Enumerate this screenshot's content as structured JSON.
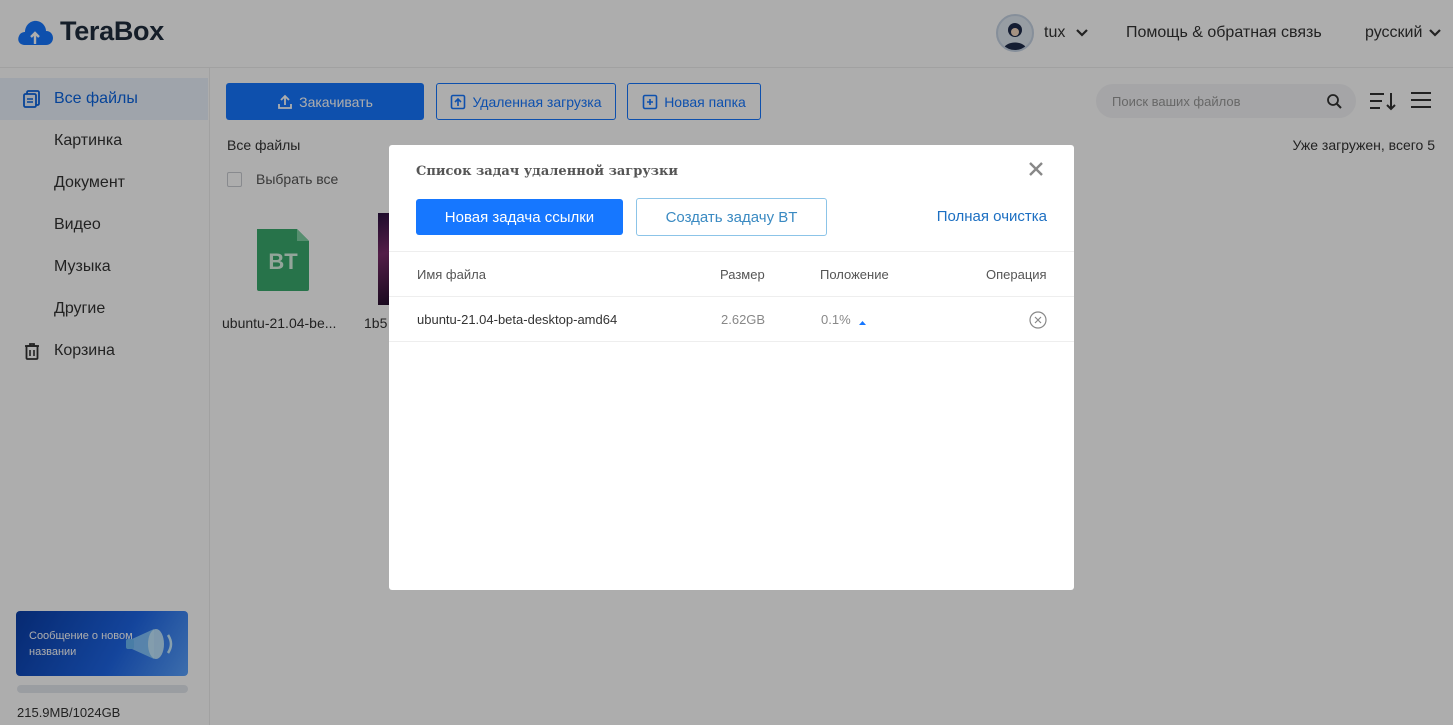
{
  "header": {
    "brand": "TeraBox",
    "username": "tux",
    "help_link": "Помощь & обратная связь",
    "language": "русский"
  },
  "sidebar": {
    "items": [
      {
        "label": "Все файлы",
        "icon": "files-icon",
        "active": true
      },
      {
        "label": "Картинка"
      },
      {
        "label": "Документ"
      },
      {
        "label": "Видео"
      },
      {
        "label": "Музыка"
      },
      {
        "label": "Другие"
      },
      {
        "label": "Корзина",
        "icon": "trash-icon"
      }
    ],
    "promo_text": "Сообщение о новом названии",
    "quota_text": "215.9MB/1024GB",
    "quota_used_fraction": 0.0002
  },
  "toolbar": {
    "upload_label": "Закачивать",
    "remote_label": "Удаленная загрузка",
    "new_folder_label": "Новая папка",
    "search_placeholder": "Поиск ваших файлов"
  },
  "content": {
    "breadcrumb": "Все файлы",
    "loaded_status": "Уже загружен, всего 5",
    "select_all": "Выбрать все",
    "files": [
      {
        "name": "ubuntu-21.04-be...",
        "badge": "BT"
      },
      {
        "name": "1b5"
      }
    ]
  },
  "modal": {
    "title": "Список задач удаленной загрузки",
    "new_link_task": "Новая задача ссылки",
    "create_bt_task": "Создать задачу BT",
    "clear_all": "Полная очистка",
    "columns": {
      "name": "Имя файла",
      "size": "Размер",
      "position": "Положение",
      "operation": "Операция"
    },
    "rows": [
      {
        "name": "ubuntu-21.04-beta-desktop-amd64",
        "size": "2.62GB",
        "position": "0.1%"
      }
    ]
  },
  "colors": {
    "accent": "#1677ff",
    "bt_icon": "#3aaa6e"
  }
}
